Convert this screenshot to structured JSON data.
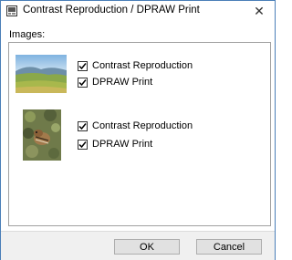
{
  "window": {
    "title": "Contrast Reproduction / DPRAW Print"
  },
  "images_label": "Images:",
  "items": [
    {
      "thumbnail": "landscape-thumbnail",
      "options": [
        {
          "label": "Contrast Reproduction",
          "checked": true
        },
        {
          "label": "DPRAW Print",
          "checked": true
        }
      ]
    },
    {
      "thumbnail": "chipmunk-thumbnail",
      "options": [
        {
          "label": "Contrast Reproduction",
          "checked": true
        },
        {
          "label": "DPRAW Print",
          "checked": true
        }
      ]
    }
  ],
  "buttons": {
    "ok_label": "OK",
    "cancel_label": "Cancel"
  },
  "icons": {
    "app": "app-icon",
    "close": "close-icon",
    "check": "checkmark-icon"
  },
  "colors": {
    "window_border": "#4a7fb8",
    "footer_bg": "#f0f0f0",
    "button_bg": "#e1e1e1"
  }
}
